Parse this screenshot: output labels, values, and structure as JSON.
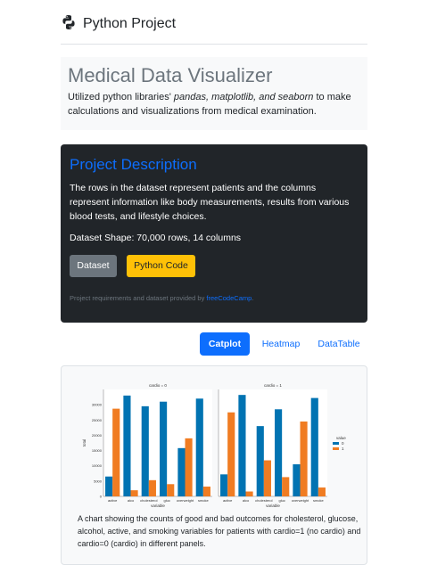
{
  "header": {
    "brand": "Python Project",
    "logo_icon": "python-logo-icon"
  },
  "hero": {
    "title": "Medical Data Visualizer",
    "text_prefix": "Utilized python libraries' ",
    "text_em": "pandas, matplotlib, and seaborn",
    "text_suffix": " to make calculations and visualizations from medical examination."
  },
  "project": {
    "title": "Project Description",
    "description": "The rows in the dataset represent patients and the columns represent information like body measurements, results from various blood tests, and lifestyle choices.",
    "shape": "Dataset Shape: 70,000 rows, 14 columns",
    "dataset_button": "Dataset",
    "code_button": "Python Code",
    "credit_prefix": "Project requirements and dataset provided by ",
    "credit_link": "freeCodeCamp",
    "credit_suffix": "."
  },
  "tabs": [
    {
      "label": "Catplot",
      "active": true
    },
    {
      "label": "Heatmap",
      "active": false
    },
    {
      "label": "DataTable",
      "active": false
    }
  ],
  "chart_data": {
    "type": "bar",
    "categories": [
      "active",
      "alco",
      "cholesterol",
      "gluc",
      "overweight",
      "smoke"
    ],
    "panels": [
      {
        "title": "cardio = 0",
        "series": [
          {
            "name": "0",
            "values": [
              6500,
              33000,
              29500,
              31000,
              15800,
              32000
            ]
          },
          {
            "name": "1",
            "values": [
              28700,
              2000,
              5300,
              4000,
              19000,
              3200
            ]
          }
        ]
      },
      {
        "title": "cardio = 1",
        "series": [
          {
            "name": "0",
            "values": [
              7200,
              33200,
              23000,
              28500,
              10500,
              32200
            ]
          },
          {
            "name": "1",
            "values": [
              27500,
              1600,
              11800,
              6300,
              24500,
              2900
            ]
          }
        ]
      }
    ],
    "xlabel": "variable",
    "ylabel": "total",
    "yticks": [
      0,
      5000,
      10000,
      15000,
      20000,
      25000,
      30000
    ],
    "ylim": [
      0,
      35000
    ],
    "legend_title": "value",
    "legend_placement": "right",
    "colors": {
      "0": "#0173b2",
      "1": "#f07c22"
    }
  },
  "caption": "A chart showing the counts of good and bad outcomes for cholesterol, glucose, alcohol, active, and smoking variables for patients with cardio=1 (no cardio) and cardio=0 (cardio) in different panels."
}
